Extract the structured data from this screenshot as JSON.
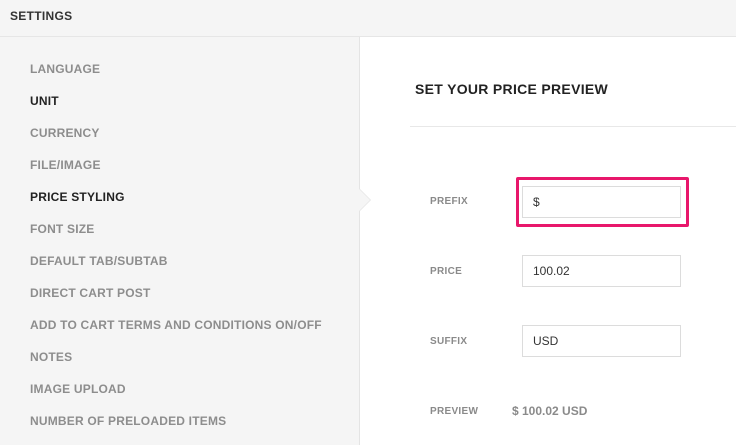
{
  "header": {
    "title": "SETTINGS"
  },
  "sidebar": {
    "items": [
      {
        "label": "LANGUAGE",
        "active": false
      },
      {
        "label": "UNIT",
        "active": true
      },
      {
        "label": "CURRENCY",
        "active": false
      },
      {
        "label": "FILE/IMAGE",
        "active": false
      },
      {
        "label": "PRICE STYLING",
        "active": true
      },
      {
        "label": "FONT SIZE",
        "active": false
      },
      {
        "label": "DEFAULT TAB/SUBTAB",
        "active": false
      },
      {
        "label": "DIRECT CART POST",
        "active": false
      },
      {
        "label": "ADD TO CART TERMS AND CONDITIONS ON/OFF",
        "active": false
      },
      {
        "label": "NOTES",
        "active": false
      },
      {
        "label": "IMAGE UPLOAD",
        "active": false
      },
      {
        "label": "NUMBER OF PRELOADED ITEMS",
        "active": false
      }
    ]
  },
  "main": {
    "title": "SET YOUR PRICE PREVIEW",
    "prefix": {
      "label": "PREFIX",
      "value": "$"
    },
    "price": {
      "label": "PRICE",
      "value": "100.02"
    },
    "suffix": {
      "label": "SUFFIX",
      "value": "USD"
    },
    "preview": {
      "label": "PREVIEW",
      "value": "$ 100.02 USD"
    }
  },
  "colors": {
    "highlight": "#e8176b",
    "active_text": "#222222",
    "muted_text": "#8d8d8d"
  }
}
